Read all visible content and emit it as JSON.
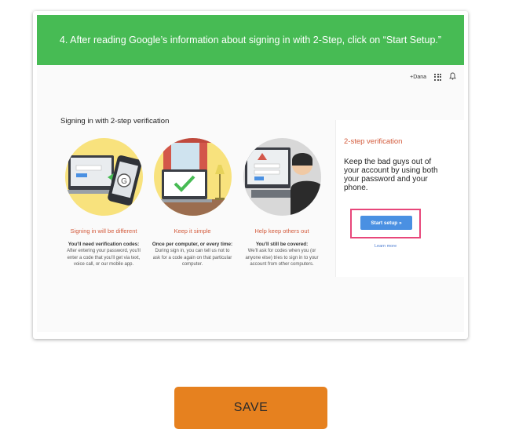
{
  "banner": {
    "text": "4. After reading Google’s information about signing in with 2-Step, click on “Start Setup.”"
  },
  "screenshot": {
    "topbar": {
      "user": "+Dana"
    },
    "page_title": "Signing in with 2-step verification",
    "steps": [
      {
        "title": "Signing in will be different",
        "bold": "You’ll need verification codes:",
        "desc": "After entering your password, you’ll enter a code that you’ll get via text, voice call, or our mobile app."
      },
      {
        "title": "Keep it simple",
        "bold": "Once per computer, or every time:",
        "desc": "During sign in, you can tell us not to ask for a code again on that particular computer."
      },
      {
        "title": "Help keep others out",
        "bold": "You’ll still be covered:",
        "desc": "We’ll ask for codes when you (or anyone else) tries to sign in to your account from other computers."
      }
    ],
    "sidebar": {
      "title": "2-step verification",
      "text": "Keep the bad guys out of your account by using both your password and your phone.",
      "start_button": "Start setup »",
      "learn_more": "Learn more"
    }
  },
  "save_button": "SAVE",
  "colors": {
    "banner": "#47bb54",
    "accent_red": "#d35a3b",
    "button_blue": "#4a90e2",
    "highlight": "#e8467a",
    "save": "#e6811f"
  }
}
